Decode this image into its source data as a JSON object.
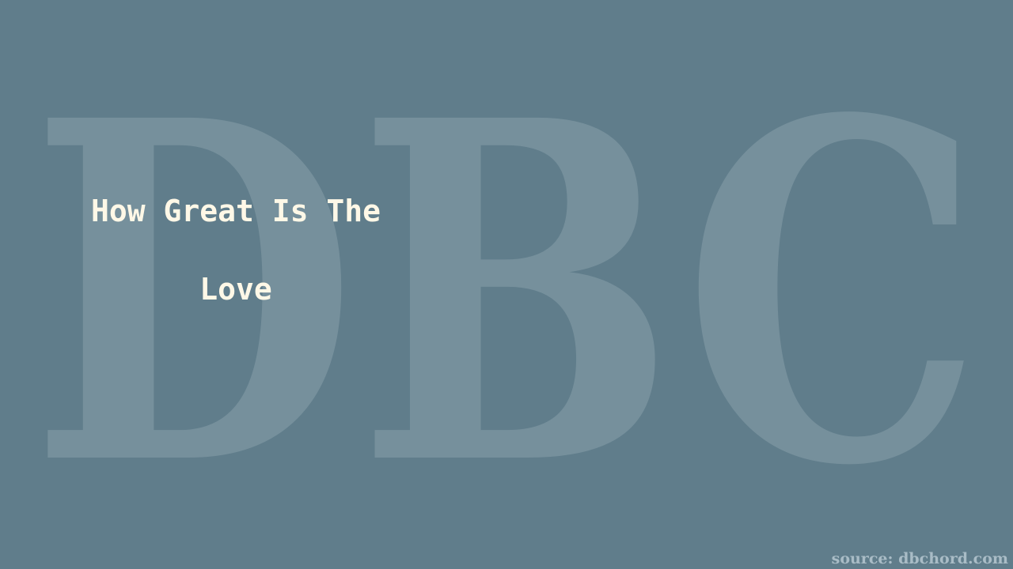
{
  "watermark": {
    "text": "DBC",
    "color": "#76909c"
  },
  "title": {
    "line1": "How Great Is The",
    "line2": "Love",
    "color": "#fff8e7"
  },
  "source": {
    "text": "source: dbchord.com"
  },
  "colors": {
    "background": "#607d8b"
  }
}
